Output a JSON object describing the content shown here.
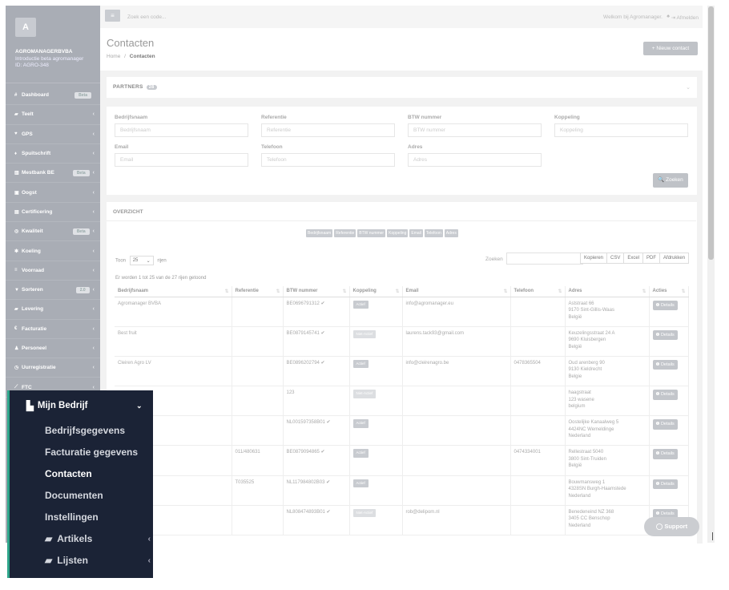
{
  "sidebar": {
    "logo_letter": "A",
    "company": "AGROMANAGERBVBA",
    "subtitle1": "Introductie beta agromanager",
    "subtitle2": "ID: AGRO-348",
    "items": [
      {
        "icon": "#",
        "label": "Dashboard",
        "badge": "Beta",
        "chev": ""
      },
      {
        "icon": "▰",
        "label": "Teelt",
        "badge": "",
        "chev": "‹"
      },
      {
        "icon": "♥",
        "label": "GPS",
        "badge": "",
        "chev": "‹"
      },
      {
        "icon": "♦",
        "label": "Spuitschrift",
        "badge": "",
        "chev": "‹"
      },
      {
        "icon": "▥",
        "label": "Mestbank BE",
        "badge": "Beta",
        "chev": "‹"
      },
      {
        "icon": "▣",
        "label": "Oogst",
        "badge": "",
        "chev": "‹"
      },
      {
        "icon": "▤",
        "label": "Certificering",
        "badge": "",
        "chev": "‹"
      },
      {
        "icon": "◎",
        "label": "Kwaliteit",
        "badge": "Beta",
        "chev": "‹"
      },
      {
        "icon": "✱",
        "label": "Koeling",
        "badge": "",
        "chev": "‹"
      },
      {
        "icon": "≡",
        "label": "Voorraad",
        "badge": "",
        "chev": "‹"
      },
      {
        "icon": "▼",
        "label": "Sorteren",
        "badge": "2.0",
        "chev": "‹"
      },
      {
        "icon": "▰",
        "label": "Levering",
        "badge": "",
        "chev": "‹"
      },
      {
        "icon": "€",
        "label": "Facturatie",
        "badge": "",
        "chev": "‹"
      },
      {
        "icon": "♟",
        "label": "Personeel",
        "badge": "",
        "chev": "‹"
      },
      {
        "icon": "◷",
        "label": "Uurregistratie",
        "badge": "",
        "chev": "‹"
      },
      {
        "icon": "⟋",
        "label": "FTC",
        "badge": "",
        "chev": "‹"
      }
    ]
  },
  "topbar": {
    "menu_icon": "≡",
    "search_placeholder": "Zoek een code...",
    "welcome": "Welkom bij Agromanager.",
    "bell": "♠",
    "logout": "⇥ Afmelden"
  },
  "header": {
    "title": "Contacten",
    "crumb_home": "Home",
    "crumb_sep": "/",
    "crumb_current": "Contacten",
    "new_button": "+ Nieuw contact"
  },
  "partners": {
    "title": "PARTNERS",
    "count": "28",
    "collapse_icon": "⌄"
  },
  "filters": {
    "bedrijfsnaam": {
      "label": "Bedrijfsnaam",
      "placeholder": "Bedrijfsnaam"
    },
    "referentie": {
      "label": "Referentie",
      "placeholder": "Referentie"
    },
    "btw": {
      "label": "BTW nummer",
      "placeholder": "BTW nummer"
    },
    "koppeling": {
      "label": "Koppeling",
      "placeholder": "Koppeling"
    },
    "email": {
      "label": "Email",
      "placeholder": "Email"
    },
    "telefoon": {
      "label": "Telefoon",
      "placeholder": "Telefoon"
    },
    "adres": {
      "label": "Adres",
      "placeholder": "Adres"
    },
    "zoek_button": "🔍 Zoeken"
  },
  "overview": {
    "title": "OVERZICHT",
    "colvis": [
      "Bedrijfsnaam",
      "Referentie",
      "BTW nummer",
      "Koppeling",
      "Email",
      "Telefoon",
      "Adres"
    ],
    "show_label": "Toon",
    "show_value": "25",
    "show_suffix": "rijen",
    "search_label": "Zoeken",
    "export": [
      "Kopieren",
      "CSV",
      "Excel",
      "PDF",
      "Afdrukken"
    ],
    "info": "Er worden 1 tot 25 van de 27 rijen getoond",
    "columns": [
      "Bedrijfsnaam",
      "Referentie",
      "BTW nummer",
      "Koppeling",
      "Email",
      "Telefoon",
      "Adres",
      "Acties"
    ],
    "sort_icons": [
      "⇅",
      "⇅",
      "⇅",
      "⇅",
      "⇅",
      "⇅",
      "⇅",
      "⇅"
    ],
    "details_label": "❶ Details",
    "rows": [
      {
        "name": "Agromanager BVBA",
        "ref": "",
        "btw": "BE0696791312 ✔",
        "status": "Actief",
        "active": true,
        "email": "info@agromanager.eu",
        "tel": "",
        "addr": [
          "Aststraat 66",
          "9170 Sint-Gillis-Waas",
          "België"
        ]
      },
      {
        "name": "Best fruit",
        "ref": "",
        "btw": "BE0879145741 ✔",
        "status": "Niet-Actief",
        "active": false,
        "email": "laurens.tack93@gmail.com",
        "tel": "",
        "addr": [
          "Keuzelingsstraat 24 A",
          "9690 Kluisbergen",
          "België"
        ]
      },
      {
        "name": "Cleiren Agro LV",
        "ref": "",
        "btw": "BE0896202794 ✔",
        "status": "Actief",
        "active": true,
        "email": "info@cleirenagro.be",
        "tel": "0478365504",
        "addr": [
          "Oud arenberg 90",
          "9130 Kieldrecht",
          "Belgie"
        ]
      },
      {
        "name": "",
        "ref": "",
        "btw": "123",
        "status": "Niet-Actief",
        "active": false,
        "email": "",
        "tel": "",
        "addr": [
          "haagstraat",
          "123 wasene",
          "belgium"
        ]
      },
      {
        "name": "",
        "ref": "",
        "btw": "NL001597358B01 ✔",
        "status": "Actief",
        "active": true,
        "email": "",
        "tel": "",
        "addr": [
          "Oostelijke Kanaalweg 5",
          "4424NC Wemeldinge",
          "Nederland"
        ]
      },
      {
        "name": "",
        "ref": "011/480631",
        "btw": "BE0879094865 ✔",
        "status": "Actief",
        "active": true,
        "email": "",
        "tel": "0474334001",
        "addr": [
          "Rellestraat 5040",
          "3800 Sint-Truiden",
          "België"
        ]
      },
      {
        "name": "",
        "ref": "T035525",
        "btw": "NL117984802B03 ✔",
        "status": "Actief",
        "active": true,
        "email": "",
        "tel": "",
        "addr": [
          "Bouwmansweg 1",
          "4328SN Burgh-Haamstede",
          "Nederland"
        ]
      },
      {
        "name": "",
        "ref": "",
        "btw": "NL808474893B01 ✔",
        "status": "Niet-Actief",
        "active": false,
        "email": "rob@delipom.nl",
        "tel": "",
        "addr": [
          "Benedeneind NZ 368",
          "3405 CC Benschop",
          "Nederland"
        ]
      }
    ]
  },
  "support_button": "◯ Support",
  "dropdown": {
    "title": "Mijn Bedrijf",
    "title_icon": "▙",
    "chevron": "⌄",
    "items": [
      "Bedrijfsgegevens",
      "Facturatie gegevens",
      "Contacten",
      "Documenten",
      "Instellingen"
    ],
    "active": "Contacten",
    "folders": [
      {
        "icon": "▰",
        "label": "Artikels",
        "chev": "‹"
      },
      {
        "icon": "▰",
        "label": "Lijsten",
        "chev": "‹"
      }
    ]
  }
}
